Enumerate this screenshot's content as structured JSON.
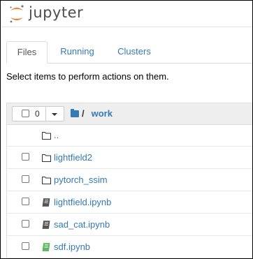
{
  "header": {
    "logo_text": "jupyter"
  },
  "tabs": [
    {
      "label": "Files",
      "active": true
    },
    {
      "label": "Running",
      "active": false
    },
    {
      "label": "Clusters",
      "active": false
    }
  ],
  "instructions": "Select items to perform actions on them.",
  "toolbar": {
    "selected_count": "0"
  },
  "breadcrumb": {
    "separator": "/",
    "current": "work"
  },
  "items": [
    {
      "name": "..",
      "type": "folder",
      "icon": "folder-icon",
      "has_checkbox": false
    },
    {
      "name": "lightfield2",
      "type": "folder",
      "icon": "folder-icon",
      "has_checkbox": true
    },
    {
      "name": "pytorch_ssim",
      "type": "folder",
      "icon": "folder-icon",
      "has_checkbox": true
    },
    {
      "name": "lightfield.ipynb",
      "type": "notebook",
      "icon": "notebook-icon",
      "has_checkbox": true,
      "running": false
    },
    {
      "name": "sad_cat.ipynb",
      "type": "notebook",
      "icon": "notebook-icon",
      "has_checkbox": true,
      "running": false
    },
    {
      "name": "sdf.ipynb",
      "type": "notebook",
      "icon": "notebook-icon",
      "has_checkbox": true,
      "running": true
    }
  ],
  "colors": {
    "link": "#337ab7",
    "logo_orange": "#f37726",
    "running_notebook": "#5cb85c",
    "notebook": "#555555"
  }
}
